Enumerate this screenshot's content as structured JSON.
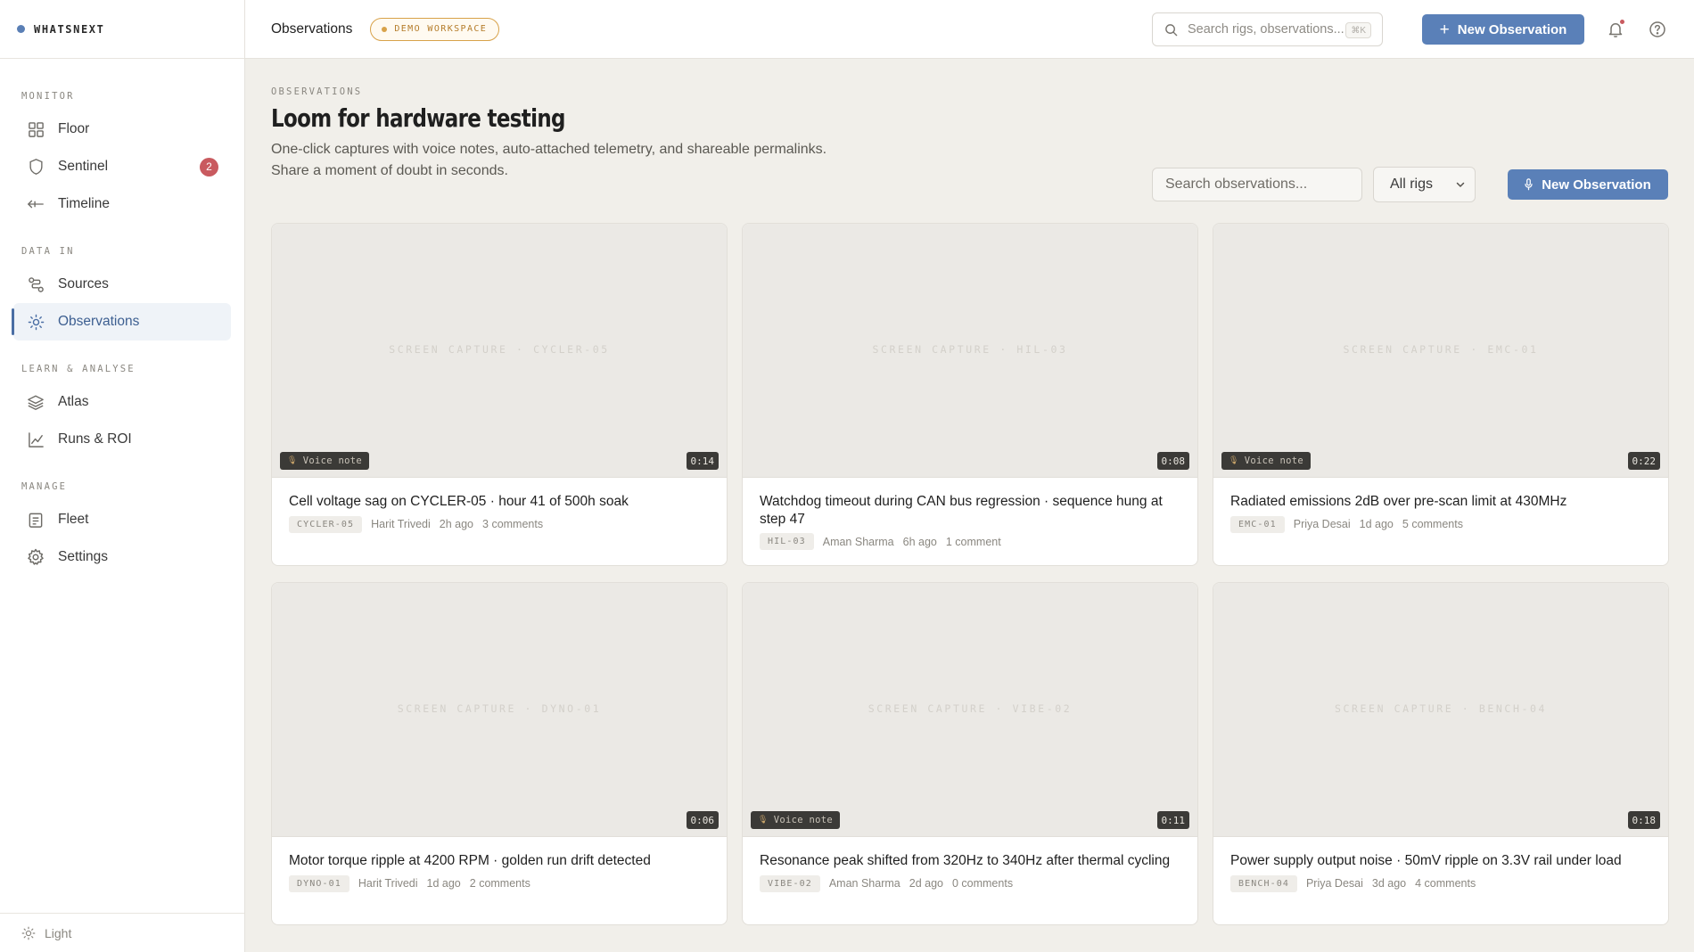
{
  "brand": {
    "name": "WHATSNEXT"
  },
  "sidebar": {
    "sections": [
      {
        "label": "MONITOR",
        "items": [
          {
            "label": "Floor",
            "icon": "grid-icon"
          },
          {
            "label": "Sentinel",
            "icon": "shield-icon",
            "badge": "2"
          },
          {
            "label": "Timeline",
            "icon": "timeline-icon"
          }
        ]
      },
      {
        "label": "DATA IN",
        "items": [
          {
            "label": "Sources",
            "icon": "route-icon"
          },
          {
            "label": "Observations",
            "icon": "sun-icon",
            "active": true
          }
        ]
      },
      {
        "label": "LEARN & ANALYSE",
        "items": [
          {
            "label": "Atlas",
            "icon": "layers-icon"
          },
          {
            "label": "Runs & ROI",
            "icon": "chart-icon"
          }
        ]
      },
      {
        "label": "MANAGE",
        "items": [
          {
            "label": "Fleet",
            "icon": "clipboard-icon"
          },
          {
            "label": "Settings",
            "icon": "gear-icon"
          }
        ]
      }
    ],
    "theme_label": "Light"
  },
  "topbar": {
    "title": "Observations",
    "workspace_badge": "DEMO WORKSPACE",
    "search_placeholder": "Search rigs, observations...",
    "search_shortcut": "⌘K",
    "new_button": "New Observation"
  },
  "page": {
    "eyebrow": "OBSERVATIONS",
    "title": "Loom for hardware testing",
    "subtitle_line1": "One-click captures with voice notes, auto-attached telemetry, and shareable permalinks.",
    "subtitle_line2": "Share a moment of doubt in seconds.",
    "search_placeholder": "Search observations...",
    "rig_filter": "All rigs",
    "new_button": "New Observation"
  },
  "voice_note_label": "Voice note",
  "observations": [
    {
      "capture": "SCREEN CAPTURE · CYCLER-05",
      "voice": true,
      "duration": "0:14",
      "title": "Cell voltage sag on CYCLER-05 · hour 41 of 500h soak",
      "rig": "CYCLER-05",
      "author": "Harit Trivedi",
      "time": "2h ago",
      "comments": "3 comments"
    },
    {
      "capture": "SCREEN CAPTURE · HIL-03",
      "voice": false,
      "duration": "0:08",
      "title": "Watchdog timeout during CAN bus regression · sequence hung at step 47",
      "rig": "HIL-03",
      "author": "Aman Sharma",
      "time": "6h ago",
      "comments": "1 comment"
    },
    {
      "capture": "SCREEN CAPTURE · EMC-01",
      "voice": true,
      "duration": "0:22",
      "title": "Radiated emissions 2dB over pre-scan limit at 430MHz",
      "rig": "EMC-01",
      "author": "Priya Desai",
      "time": "1d ago",
      "comments": "5 comments"
    },
    {
      "capture": "SCREEN CAPTURE · DYNO-01",
      "voice": false,
      "duration": "0:06",
      "title": "Motor torque ripple at 4200 RPM · golden run drift detected",
      "rig": "DYNO-01",
      "author": "Harit Trivedi",
      "time": "1d ago",
      "comments": "2 comments"
    },
    {
      "capture": "SCREEN CAPTURE · VIBE-02",
      "voice": true,
      "duration": "0:11",
      "title": "Resonance peak shifted from 320Hz to 340Hz after thermal cycling",
      "rig": "VIBE-02",
      "author": "Aman Sharma",
      "time": "2d ago",
      "comments": "0 comments"
    },
    {
      "capture": "SCREEN CAPTURE · BENCH-04",
      "voice": false,
      "duration": "0:18",
      "title": "Power supply output noise · 50mV ripple on 3.3V rail under load",
      "rig": "BENCH-04",
      "author": "Priya Desai",
      "time": "3d ago",
      "comments": "4 comments"
    }
  ]
}
